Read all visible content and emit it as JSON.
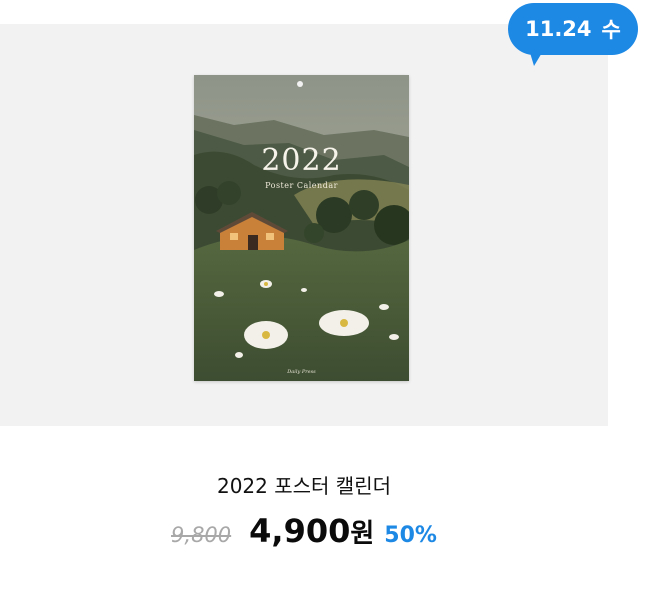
{
  "badge": {
    "date": "11.24",
    "weekday": "수",
    "color": "#1e88e5"
  },
  "product": {
    "title": "2022 포스터 캘린더",
    "original_price": "9,800",
    "sale_price": "4,900",
    "currency": "원",
    "discount": "50%",
    "accent_color": "#1e88e5"
  },
  "poster": {
    "year": "2022",
    "subtitle": "Poster Calendar",
    "brand": "Daily Press"
  }
}
